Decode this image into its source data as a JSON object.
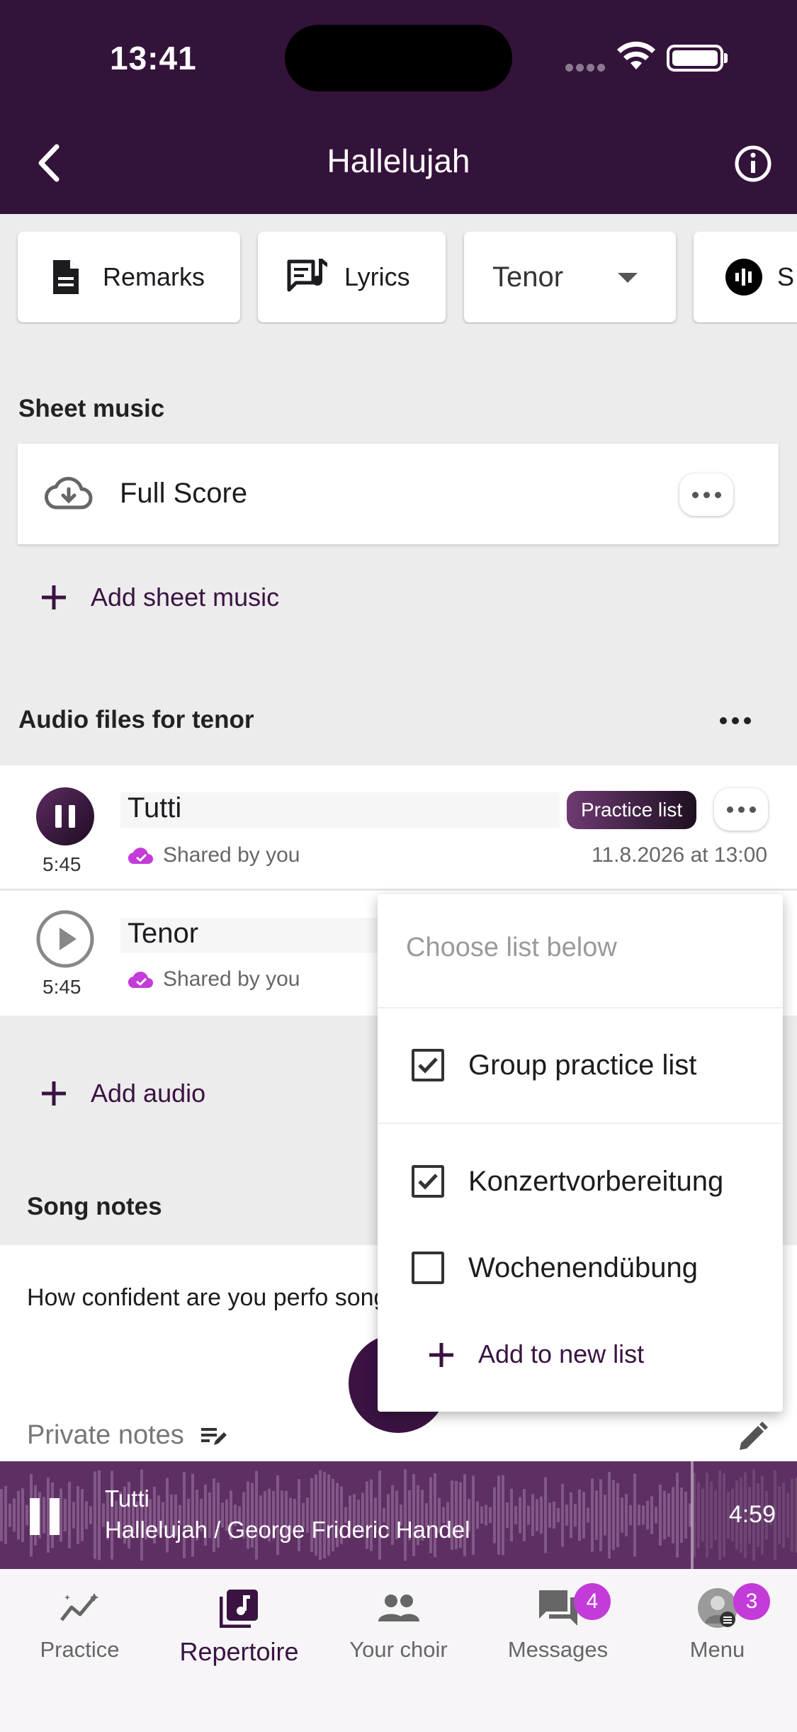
{
  "status": {
    "time": "13:41"
  },
  "header": {
    "title": "Hallelujah"
  },
  "chips": {
    "remarks": "Remarks",
    "lyrics": "Lyrics",
    "voice": "Tenor",
    "partial": "S"
  },
  "sheet_music": {
    "section_title": "Sheet music",
    "items": [
      {
        "label": "Full Score"
      }
    ],
    "add_label": "Add sheet music"
  },
  "audio": {
    "section_title": "Audio files for tenor",
    "items": [
      {
        "title": "Tutti",
        "duration": "5:45",
        "shared": "Shared by you",
        "badge": "Practice list",
        "date": "11.8.2026 at 13:00",
        "playing": true
      },
      {
        "title": "Tenor",
        "duration": "5:45",
        "shared": "Shared by you",
        "playing": false
      }
    ],
    "add_label": "Add audio"
  },
  "dropdown": {
    "heading": "Choose list below",
    "lists": [
      {
        "label": "Group practice list",
        "checked": true
      },
      {
        "label": "Konzertvorbereitung",
        "checked": true
      },
      {
        "label": "Wochenendübung",
        "checked": false
      }
    ],
    "add_label": "Add to new list"
  },
  "song_notes": {
    "section_title": "Song notes",
    "question": "How confident are you perfo song?",
    "private_label": "Private notes"
  },
  "player": {
    "track": "Tutti",
    "subtitle": "Hallelujah / George Frideric Handel",
    "time": "4:59"
  },
  "nav": {
    "items": [
      {
        "label": "Practice",
        "icon": "practice-chart-icon"
      },
      {
        "label": "Repertoire",
        "icon": "music-note-icon",
        "active": true
      },
      {
        "label": "Your choir",
        "icon": "people-icon"
      },
      {
        "label": "Messages",
        "icon": "chat-icon",
        "badge": "4"
      },
      {
        "label": "Menu",
        "icon": "avatar",
        "badge": "3"
      }
    ]
  },
  "colors": {
    "brand": "#34133b",
    "accent": "#c33bd8",
    "player": "#5e2f63"
  }
}
